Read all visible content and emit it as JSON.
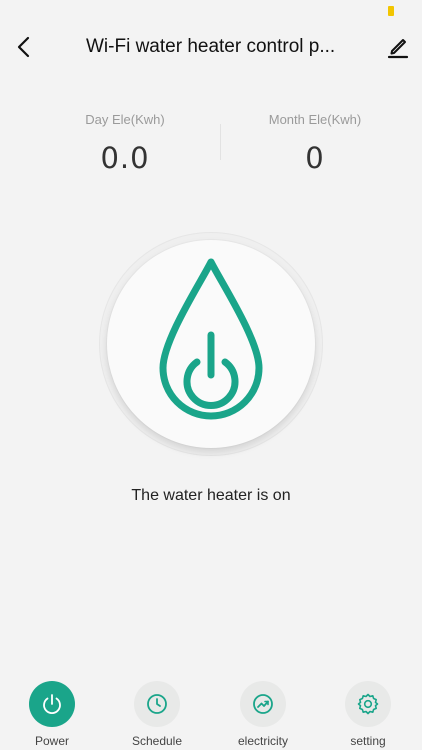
{
  "header": {
    "title": "Wi-Fi water heater control p...",
    "back_icon": "chevron-left-icon",
    "edit_icon": "pencil-icon"
  },
  "stats": {
    "day": {
      "label": "Day Ele(Kwh)",
      "value": "0.0"
    },
    "month": {
      "label": "Month Ele(Kwh)",
      "value": "0"
    }
  },
  "power": {
    "icon": "water-drop-power-icon",
    "accent_color": "#1aa58a",
    "status_text": "The water heater is on"
  },
  "tabs": [
    {
      "label": "Power",
      "icon": "power-icon",
      "active": true
    },
    {
      "label": "Schedule",
      "icon": "clock-icon",
      "active": false
    },
    {
      "label": "electricity",
      "icon": "chart-trend-icon",
      "active": false
    },
    {
      "label": "setting",
      "icon": "gear-icon",
      "active": false
    }
  ],
  "colors": {
    "accent": "#1aa58a",
    "background": "#f3f3f3",
    "battery": "#f2c500"
  }
}
